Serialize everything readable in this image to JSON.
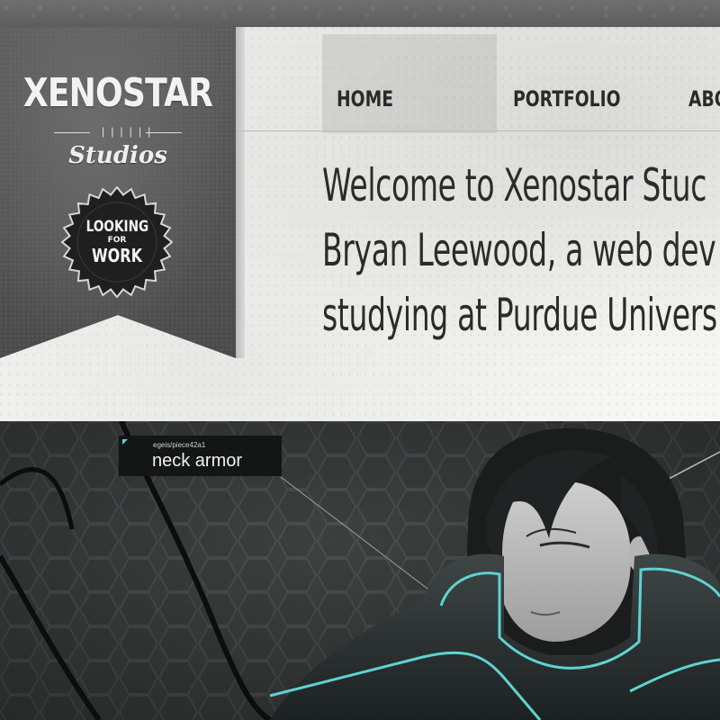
{
  "logo": {
    "title": "XENOSTAR",
    "ornament": "❘❘❘❘❘❘",
    "subtitle": "Studios"
  },
  "badge": {
    "line1": "LOOKING",
    "line2": "FOR",
    "line3": "WORK"
  },
  "nav": {
    "items": [
      {
        "label": "HOME"
      },
      {
        "label": "PORTFOLIO"
      },
      {
        "label": "ABO"
      }
    ]
  },
  "intro": {
    "lines": [
      "Welcome to Xenostar Stuc",
      "Bryan Leewood, a web dev",
      "studying at Purdue Univers"
    ]
  },
  "hero": {
    "tooltip": {
      "code": "egeis/piece42a1",
      "label": "neck armor"
    }
  },
  "colors": {
    "banner": "#4f4f4f",
    "hero_background": "#3e4241",
    "armor_glow": "#5fd3d3"
  }
}
